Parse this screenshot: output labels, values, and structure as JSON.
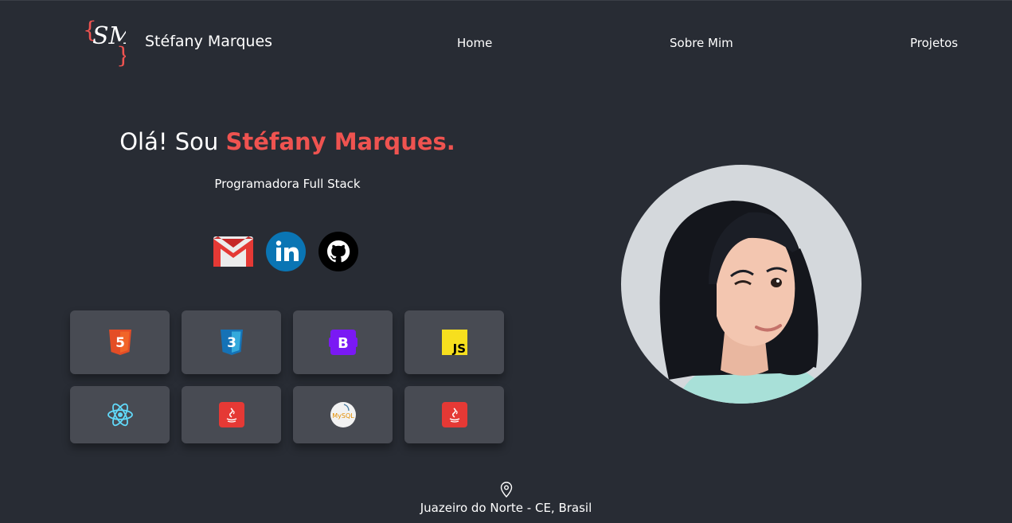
{
  "header": {
    "logo_letters": "SM",
    "brand_name": "Stéfany Marques",
    "nav": [
      {
        "label": "Home"
      },
      {
        "label": "Sobre Mim"
      },
      {
        "label": "Projetos"
      }
    ]
  },
  "hero": {
    "greeting_prefix": "Olá! Sou ",
    "greeting_name": "Stéfany Marques.",
    "subtitle": "Programadora Full Stack",
    "accent_color": "#ef5350"
  },
  "socials": [
    {
      "icon": "gmail-icon"
    },
    {
      "icon": "linkedin-icon"
    },
    {
      "icon": "github-icon"
    }
  ],
  "skills": [
    {
      "icon": "html5-icon",
      "text": "5"
    },
    {
      "icon": "css3-icon",
      "text": "3"
    },
    {
      "icon": "bootstrap-icon",
      "text": "B"
    },
    {
      "icon": "javascript-icon",
      "text": "JS"
    },
    {
      "icon": "react-icon"
    },
    {
      "icon": "java-icon"
    },
    {
      "icon": "mysql-icon",
      "text": "MySQL"
    },
    {
      "icon": "java-icon"
    }
  ],
  "avatar": {
    "icon": "avatar-illustration"
  },
  "footer": {
    "location": "Juazeiro do Norte - CE, Brasil",
    "icon": "location-pin-icon"
  }
}
